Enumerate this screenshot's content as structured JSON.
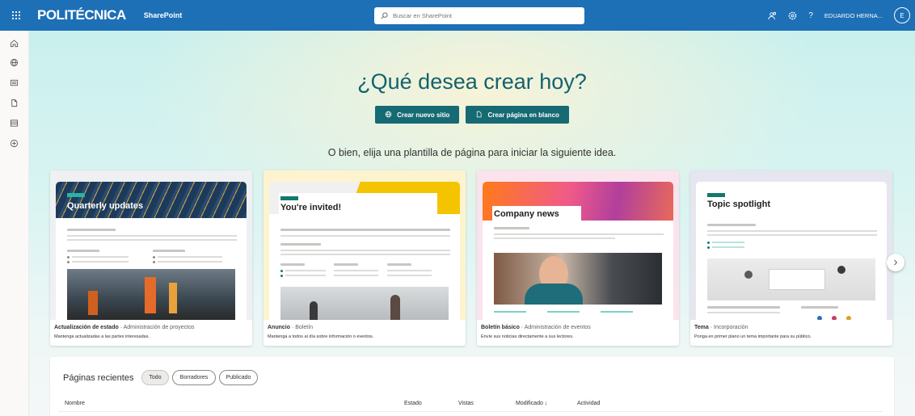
{
  "topbar": {
    "brand": "POLITÉCNICA",
    "app": "SharePoint",
    "search_placeholder": "Buscar en SharePoint",
    "user": "EDUARDO HERNA...",
    "avatar_initial": "E",
    "help": "?"
  },
  "hero": {
    "title": "¿Qué desea crear hoy?",
    "btn_site": "Crear nuevo sitio",
    "btn_page": "Crear página en blanco",
    "subtitle": "O bien, elija una plantilla de página para iniciar la siguiente idea."
  },
  "templates": [
    {
      "heading": "Quarterly updates",
      "name": "Actualización de estado",
      "category": "Administración de proyectos",
      "description": "Mantenga actualizadas a las partes interesadas."
    },
    {
      "heading": "You're invited!",
      "name": "Anuncio",
      "category": "Boletín",
      "description": "Mantenga a todos al día sobre información o eventos."
    },
    {
      "heading": "Company news",
      "name": "Boletín básico",
      "category": "Administración de eventos",
      "description": "Envíe sus noticias directamente a sus lectores."
    },
    {
      "heading": "Topic spotlight",
      "name": "Tema",
      "category": "Incorporación",
      "description": "Ponga en primer plano un tema importante para su público."
    }
  ],
  "recent": {
    "title": "Páginas recientes",
    "filters": [
      "Todo",
      "Borradores",
      "Publicado"
    ],
    "columns": [
      "Nombre",
      "Estado",
      "Vistas",
      "Modificado ↓",
      "Actividad"
    ]
  },
  "colors": {
    "topbar": "#1d6fb6",
    "accent": "#156a73",
    "title": "#14626d"
  }
}
